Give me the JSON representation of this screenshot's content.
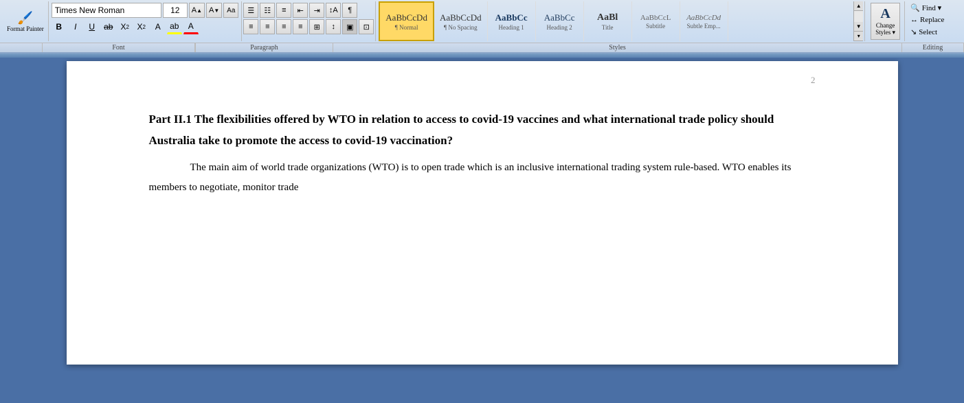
{
  "ribbon": {
    "fontName": "Times New Roman",
    "fontSize": "12",
    "styles": [
      {
        "id": "normal",
        "preview": "AaBbCcDd",
        "label": "¶ Normal",
        "active": true
      },
      {
        "id": "no-spacing",
        "preview": "AaBbCcDd",
        "label": "¶ No Spacing",
        "active": false
      },
      {
        "id": "heading1",
        "preview": "AaBbCc",
        "label": "Heading 1",
        "active": false
      },
      {
        "id": "heading2",
        "preview": "AaBbCc",
        "label": "Heading 2",
        "active": false
      },
      {
        "id": "title",
        "preview": "AaBl",
        "label": "Title",
        "active": false
      },
      {
        "id": "subtitle",
        "preview": "AaBbCcL",
        "label": "Subtitle",
        "active": false
      },
      {
        "id": "subtle-emp",
        "preview": "AaBbCcDd",
        "label": "Subtle Emp...",
        "active": false
      }
    ],
    "editing": {
      "find": "Find ▾",
      "replace": "Replace",
      "select": "Select"
    },
    "changeStyles": "Change\nStyles ▾",
    "formatPainter": "Format Painter"
  },
  "sections": {
    "font": "Font",
    "paragraph": "Paragraph",
    "styles": "Styles",
    "editing": "Editing"
  },
  "document": {
    "pageNumber": "2",
    "heading": "Part II.1 The flexibilities offered by WTO in relation to access to covid-19 vaccines and what international trade policy should Australia take to promote the access to covid-19 vaccination?",
    "paragraph1": "The main aim of world trade organizations (WTO) is to open trade which is an inclusive international trading system rule-based. WTO enables its members to negotiate, monitor trade"
  }
}
